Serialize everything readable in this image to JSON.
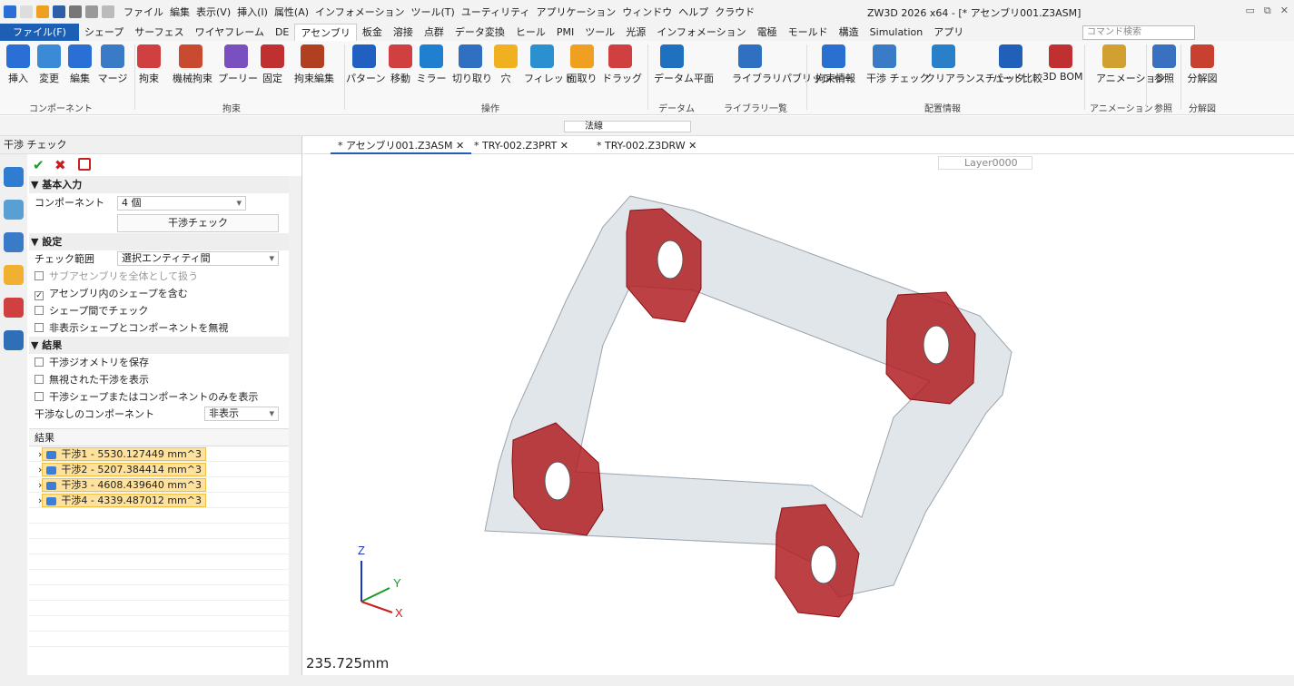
{
  "window": {
    "title": "ZW3D 2026 x64 - [* アセンブリ001.Z3ASM]",
    "controls": [
      "▭",
      "⧉",
      "✕"
    ]
  },
  "menubar": [
    "ファイル",
    "編集",
    "表示(V)",
    "挿入(I)",
    "属性(A)",
    "インフォメーション",
    "ツール(T)",
    "ユーティリティ",
    "アプリケーション",
    "ウィンドウ",
    "ヘルプ",
    "クラウド"
  ],
  "ribbon_tabs": [
    "ファイル(F)",
    "シェープ",
    "サーフェス",
    "ワイヤフレーム",
    "DE",
    "アセンブリ",
    "板金",
    "溶接",
    "点群",
    "データ変換",
    "ヒール",
    "PMI",
    "ツール",
    "光源",
    "インフォメーション",
    "電極",
    "モールド",
    "構造",
    "Simulation",
    "アプリ"
  ],
  "active_tab": "アセンブリ",
  "command_search": {
    "placeholder": "コマンド検索"
  },
  "ribbon": {
    "buttons": [
      "挿入",
      "変更",
      "編集",
      "マージ",
      "拘束",
      "機械拘束",
      "プーリー",
      "固定",
      "拘束編集",
      "パターン",
      "移動",
      "ミラー",
      "切り取り",
      "穴",
      "フィレット",
      "面取り",
      "ドラッグ",
      "データム平面",
      "ライブラリパブリッシャー",
      "拘束情報",
      "干渉 チェック",
      "クリアランスチェック",
      "パート比較",
      "3D BOM",
      "アニメーション",
      "参照",
      "分解図"
    ],
    "groups": [
      "コンポーネント",
      "拘束",
      "操作",
      "データム",
      "ライブラリ一覧",
      "配置情報",
      "アニメーション",
      "参照",
      "分解図"
    ]
  },
  "filter": {
    "value": "法線"
  },
  "layer": {
    "value": "Layer0000"
  },
  "panel": {
    "title": "干渉 チェック",
    "basic_input": "基本入力",
    "component_label": "コンポーネント",
    "component_value": "4 個",
    "check_button": "干渉チェック",
    "settings": "設定",
    "check_range_label": "チェック範囲",
    "check_range_value": "選択エンティティ間",
    "opt1": "サブアセンブリを全体として扱う",
    "opt2": "アセンブリ内のシェープを含む",
    "opt3": "シェープ間でチェック",
    "opt4": "非表示シェープとコンポーネントを無視",
    "results_section": "結果",
    "res_opt1": "干渉ジオメトリを保存",
    "res_opt2": "無視された干渉を表示",
    "res_opt3": "干渉シェープまたはコンポーネントのみを表示",
    "no_interf_label": "干渉なしのコンポーネント",
    "no_interf_value": "非表示",
    "results_header": "結果",
    "results": [
      "干渉1 - 5530.127449 mm^3",
      "干渉2 - 5207.384414 mm^3",
      "干渉3 - 4608.439640 mm^3",
      "干渉4 - 4339.487012 mm^3"
    ]
  },
  "doc_tabs": [
    "* アセンブリ001.Z3ASM",
    "* TRY-002.Z3PRT",
    "* TRY-002.Z3DRW"
  ],
  "axes": {
    "z": "Z",
    "y": "Y",
    "x": "X"
  },
  "dimension": "235.725mm",
  "colors": {
    "accent": "#1c5fb5",
    "interference": "#b01e23",
    "highlight": "#fde19c"
  }
}
